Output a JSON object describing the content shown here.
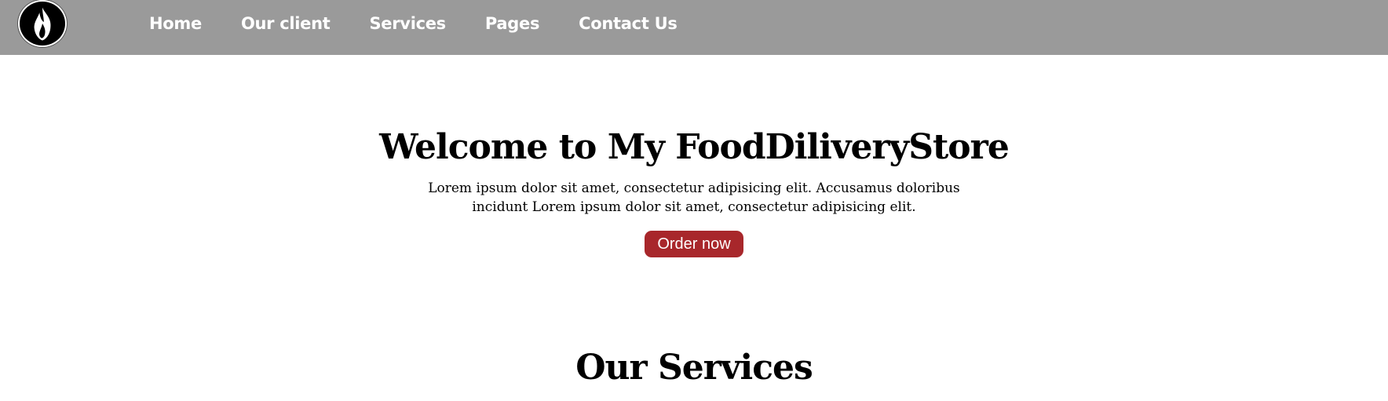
{
  "header": {
    "logo_icon": "flame-icon",
    "nav": [
      {
        "label": "Home"
      },
      {
        "label": "Our client"
      },
      {
        "label": "Services"
      },
      {
        "label": "Pages"
      },
      {
        "label": "Contact Us"
      }
    ]
  },
  "hero": {
    "title": "Welcome to My FoodDiliveryStore",
    "description": "Lorem ipsum dolor sit amet, consectetur adipisicing elit. Accusamus doloribus incidunt Lorem ipsum dolor sit amet, consectetur adipisicing elit.",
    "button_label": "Order now"
  },
  "services": {
    "title": "Our Services"
  },
  "colors": {
    "navbar": "#9a9a9a",
    "button": "#a8272b",
    "nav_text": "#ffffff"
  }
}
